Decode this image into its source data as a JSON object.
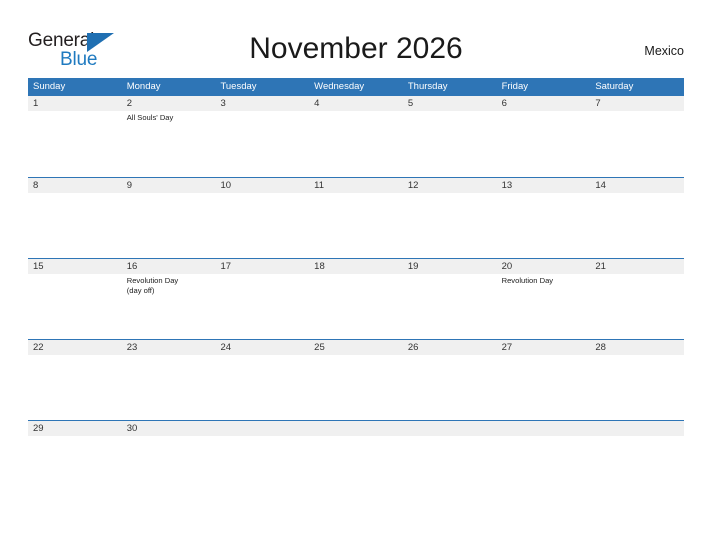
{
  "brand": {
    "name_part1": "General",
    "name_part2": "Blue",
    "triangle_icon": "triangle-right-icon",
    "colors": {
      "dark": "#231f20",
      "blue": "#1f7ac0"
    }
  },
  "header": {
    "title": "November 2026",
    "country": "Mexico"
  },
  "colors": {
    "header_blue": "#2e75b6",
    "row_band_gray": "#f0f0f0",
    "text_dark": "#1a1a1a"
  },
  "calendar": {
    "weekdays": [
      {
        "label": "Sunday"
      },
      {
        "label": "Monday"
      },
      {
        "label": "Tuesday"
      },
      {
        "label": "Wednesday"
      },
      {
        "label": "Thursday"
      },
      {
        "label": "Friday"
      },
      {
        "label": "Saturday"
      }
    ],
    "weeks": [
      {
        "days": [
          {
            "num": "1",
            "events": []
          },
          {
            "num": "2",
            "events": [
              "All Souls' Day"
            ]
          },
          {
            "num": "3",
            "events": []
          },
          {
            "num": "4",
            "events": []
          },
          {
            "num": "5",
            "events": []
          },
          {
            "num": "6",
            "events": []
          },
          {
            "num": "7",
            "events": []
          }
        ]
      },
      {
        "days": [
          {
            "num": "8",
            "events": []
          },
          {
            "num": "9",
            "events": []
          },
          {
            "num": "10",
            "events": []
          },
          {
            "num": "11",
            "events": []
          },
          {
            "num": "12",
            "events": []
          },
          {
            "num": "13",
            "events": []
          },
          {
            "num": "14",
            "events": []
          }
        ]
      },
      {
        "days": [
          {
            "num": "15",
            "events": []
          },
          {
            "num": "16",
            "events": [
              "Revolution Day",
              "(day off)"
            ]
          },
          {
            "num": "17",
            "events": []
          },
          {
            "num": "18",
            "events": []
          },
          {
            "num": "19",
            "events": []
          },
          {
            "num": "20",
            "events": [
              "Revolution Day"
            ]
          },
          {
            "num": "21",
            "events": []
          }
        ]
      },
      {
        "days": [
          {
            "num": "22",
            "events": []
          },
          {
            "num": "23",
            "events": []
          },
          {
            "num": "24",
            "events": []
          },
          {
            "num": "25",
            "events": []
          },
          {
            "num": "26",
            "events": []
          },
          {
            "num": "27",
            "events": []
          },
          {
            "num": "28",
            "events": []
          }
        ]
      },
      {
        "days": [
          {
            "num": "29",
            "events": []
          },
          {
            "num": "30",
            "events": []
          },
          {
            "num": "",
            "events": []
          },
          {
            "num": "",
            "events": []
          },
          {
            "num": "",
            "events": []
          },
          {
            "num": "",
            "events": []
          },
          {
            "num": "",
            "events": []
          }
        ]
      }
    ]
  }
}
